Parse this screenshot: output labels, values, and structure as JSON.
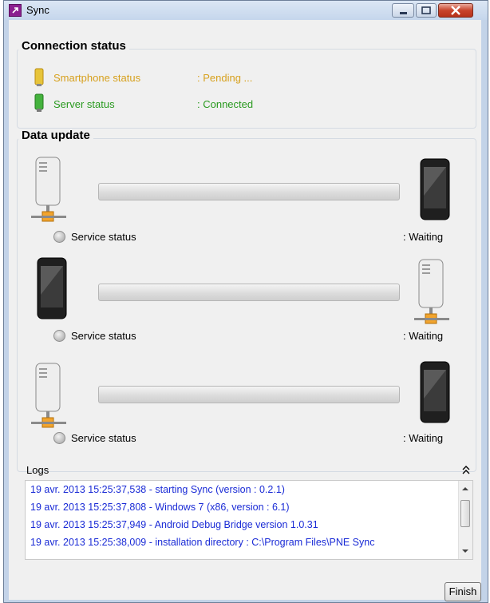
{
  "window": {
    "title": "Sync"
  },
  "connection": {
    "title": "Connection status",
    "smartphone_label": "Smartphone status",
    "smartphone_value": ": Pending ...",
    "server_label": "Server status",
    "server_value": ": Connected",
    "colors": {
      "pending": "#d7a11e",
      "connected": "#2a9a20"
    }
  },
  "data_update": {
    "title": "Data update",
    "rows": [
      {
        "from": "server-icon",
        "to": "smartphone-icon",
        "label": "Service status",
        "value": ": Waiting",
        "progress": 0
      },
      {
        "from": "smartphone-icon",
        "to": "server-icon",
        "label": "Service status",
        "value": ": Waiting",
        "progress": 0
      },
      {
        "from": "server-icon",
        "to": "smartphone-icon",
        "label": "Service status",
        "value": ": Waiting",
        "progress": 0
      }
    ]
  },
  "logs": {
    "title": "Logs",
    "lines": [
      "19 avr. 2013 15:25:37,538 - starting Sync (version : 0.2.1)",
      "19 avr. 2013 15:25:37,808 - Windows 7 (x86, version : 6.1)",
      "19 avr. 2013 15:25:37,949 - Android Debug Bridge version 1.0.31",
      "19 avr. 2013 15:25:38,009 - installation directory : C:\\Program Files\\PNE Sync"
    ],
    "color": "#1a2bd6"
  },
  "footer": {
    "finish_label": "Finish"
  }
}
